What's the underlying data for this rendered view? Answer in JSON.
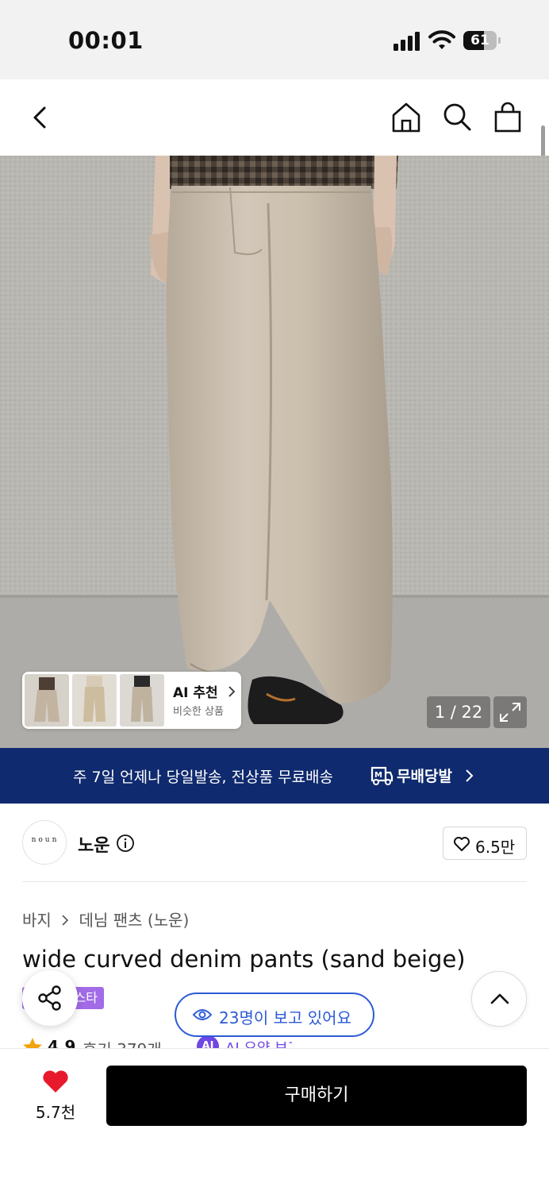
{
  "status_bar": {
    "time": "00:01",
    "battery": "61",
    "battery_level": 0.61,
    "icons": [
      "cellular-signal-icon",
      "wifi-icon",
      "battery-icon"
    ]
  },
  "nav": {
    "icons": [
      "back-arrow-icon",
      "home-icon",
      "search-icon",
      "shopping-bag-icon"
    ]
  },
  "gallery": {
    "counter": "1 / 22",
    "ai_recommend": {
      "title": "AI 추천",
      "subtitle": "비슷한 상품"
    }
  },
  "banner": {
    "text": "주 7일 언제나 당일발송, 전상품 무료배송",
    "label": "무배당발"
  },
  "brand": {
    "logo_text": "noun",
    "name": "노운",
    "likes": "6.5만"
  },
  "breadcrumb": {
    "category": "바지",
    "subcategory": "데님 팬츠 (노운)"
  },
  "product": {
    "title": "wide curved denim pants (sand beige)",
    "tag": "스타",
    "rating": "4.9",
    "reviews": "후기 379개",
    "ai_badge": "AI",
    "ai_summary": "AI 요약 보기"
  },
  "floating": {
    "viewers": "23명이 보고 있어요"
  },
  "bottom_bar": {
    "wish_count": "5.7천",
    "buy_label": "구매하기"
  },
  "colors": {
    "banner_bg": "#0f2a6e",
    "accent_blue": "#2c5bd6",
    "tag_purple": "#a26be8",
    "ai_purple": "#6f47e5",
    "heart_red": "#e8192c",
    "buy_bg": "#000000"
  }
}
